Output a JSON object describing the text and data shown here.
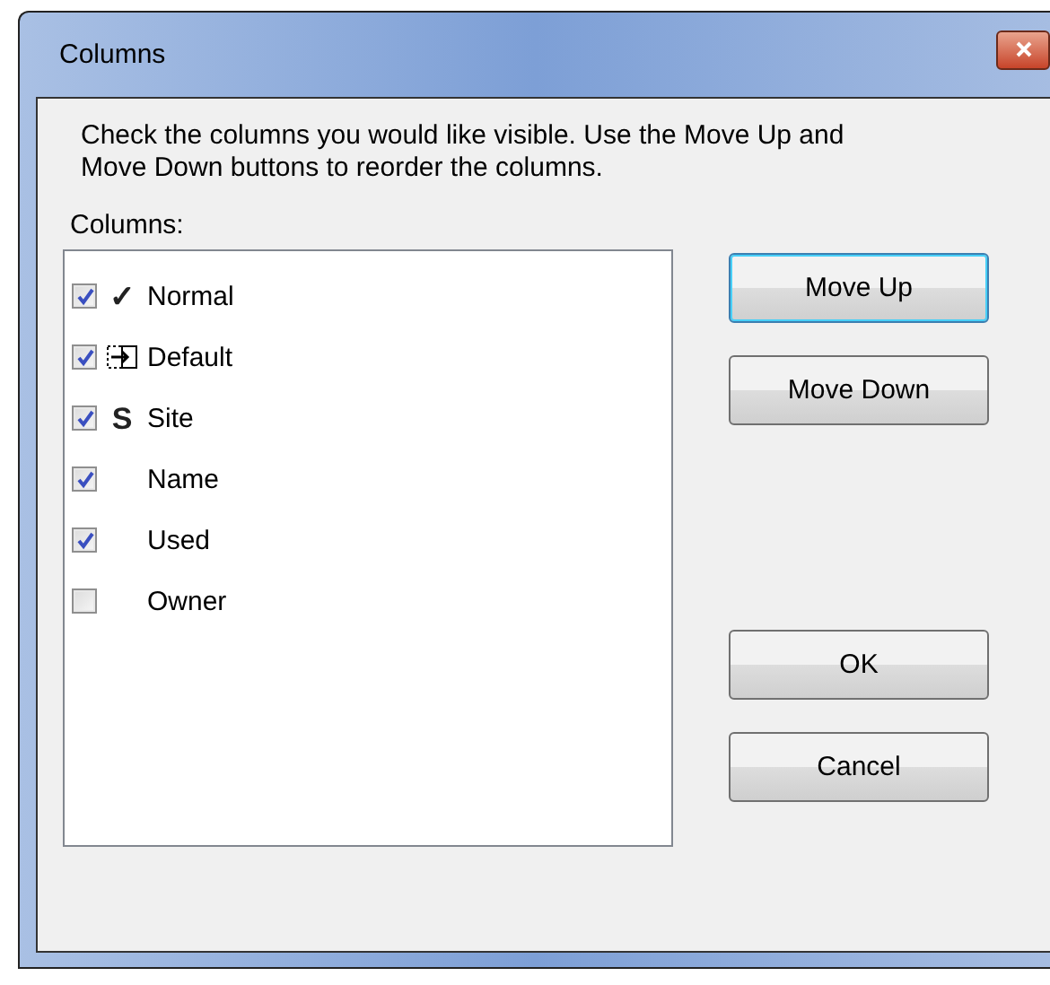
{
  "window": {
    "title": "Columns"
  },
  "instructions": "Check the columns you would like visible.  Use the Move Up and Move Down buttons to reorder the columns.",
  "list_label": "Columns:",
  "columns": [
    {
      "label": "Normal",
      "checked": true,
      "icon": {
        "kind": "glyph",
        "text": "✓"
      }
    },
    {
      "label": "Default",
      "checked": true,
      "icon": {
        "kind": "arrow-box"
      }
    },
    {
      "label": "Site",
      "checked": true,
      "icon": {
        "kind": "glyph",
        "text": "S"
      }
    },
    {
      "label": "Name",
      "checked": true
    },
    {
      "label": "Used",
      "checked": true
    },
    {
      "label": "Owner",
      "checked": false
    }
  ],
  "order_buttons": [
    {
      "label": "Move Up",
      "focused": true
    },
    {
      "label": "Move Down",
      "focused": false
    }
  ],
  "action_buttons": [
    {
      "label": "OK",
      "focused": false
    },
    {
      "label": "Cancel",
      "focused": false
    }
  ]
}
